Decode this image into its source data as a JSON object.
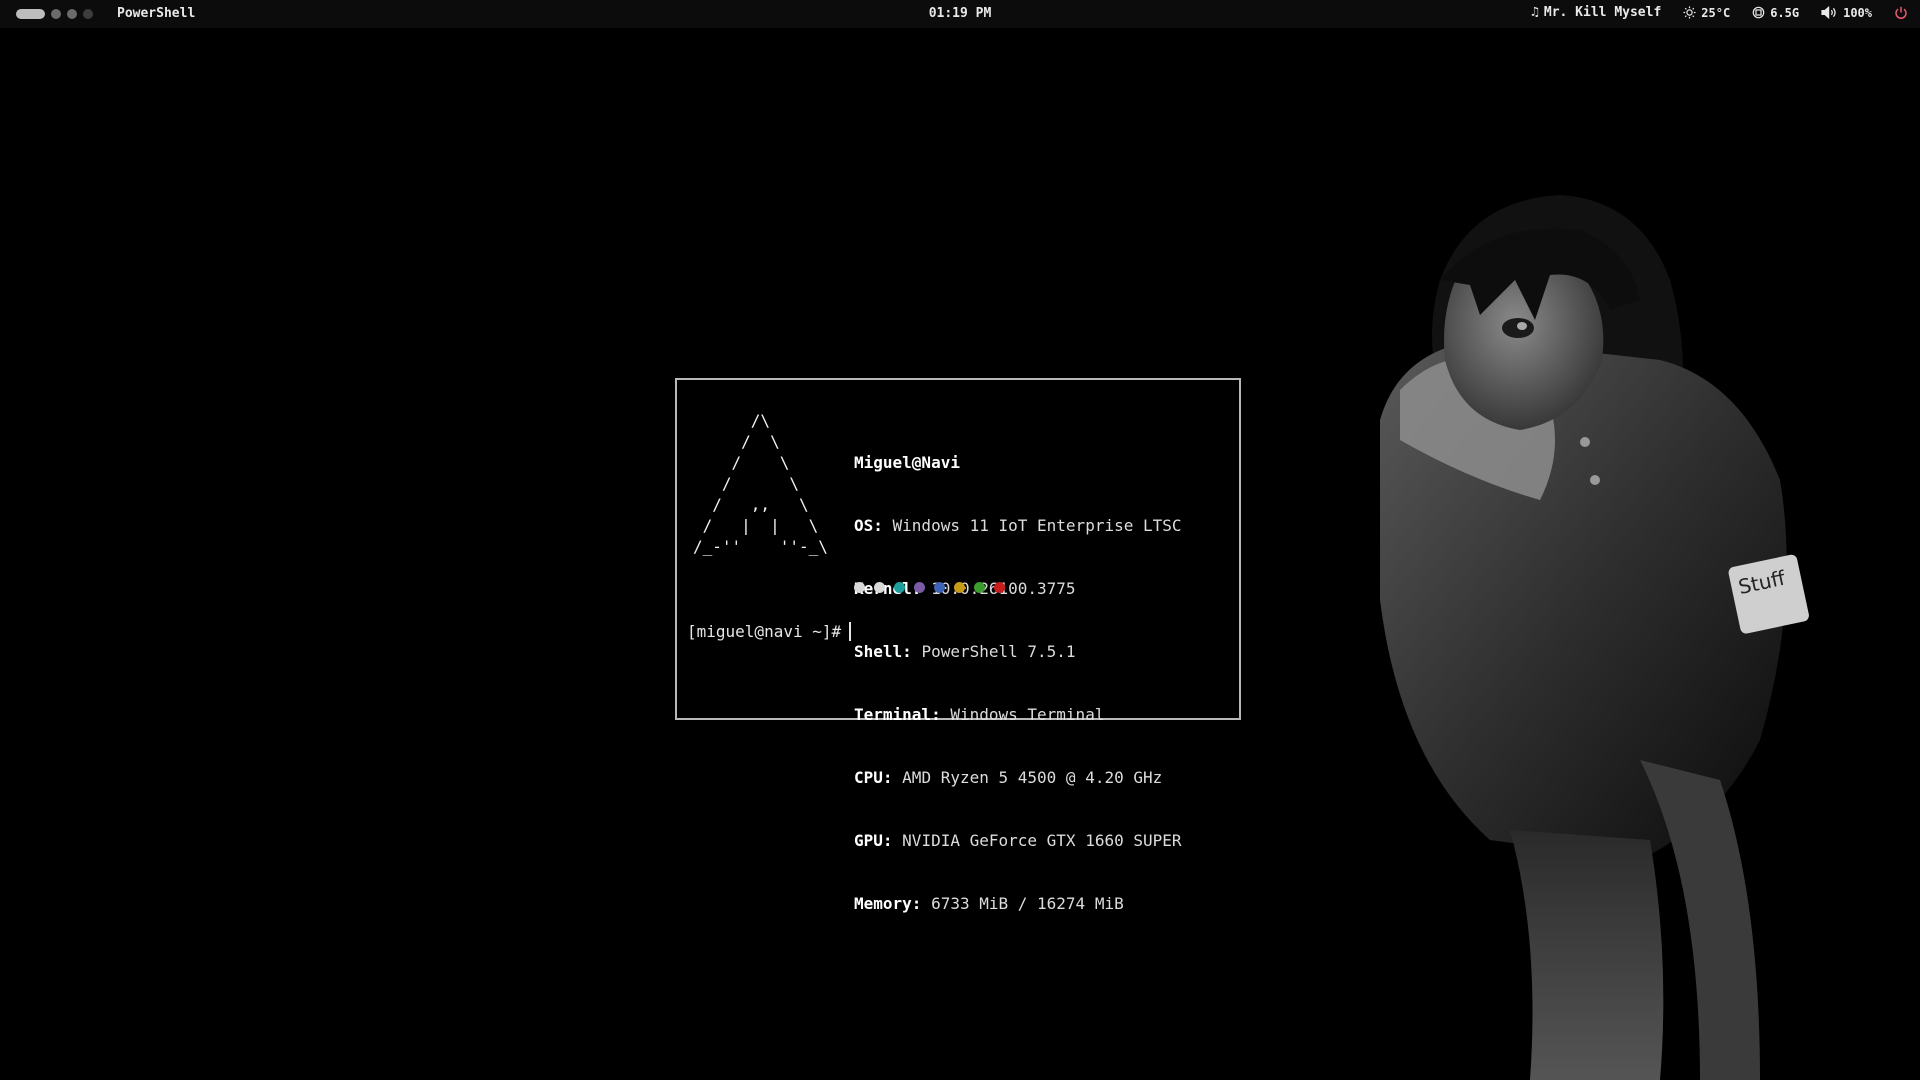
{
  "topbar": {
    "window_title": "PowerShell",
    "clock": "01:19 PM",
    "music": "Mr. Kill Myself",
    "temperature": "25°C",
    "memory": "6.5G",
    "volume": "100%"
  },
  "terminal": {
    "user_host": "Miguel@Navi",
    "logo_lines": [
      "      /\\",
      "     /  \\",
      "    /    \\",
      "   /      \\",
      "  /   ,,   \\",
      " /   |  |   \\",
      "/_-''    ''-_\\"
    ],
    "info": [
      {
        "key": "OS",
        "value": "Windows 11 IoT Enterprise LTSC"
      },
      {
        "key": "Kernel",
        "value": "10.0.26100.3775"
      },
      {
        "key": "Shell",
        "value": "PowerShell 7.5.1"
      },
      {
        "key": "Terminal",
        "value": "Windows Terminal"
      },
      {
        "key": "CPU",
        "value": "AMD Ryzen 5 4500 @ 4.20 GHz"
      },
      {
        "key": "GPU",
        "value": "NVIDIA GeForce GTX 1660 SUPER"
      },
      {
        "key": "Memory",
        "value": "6733 MiB / 16274 MiB"
      }
    ],
    "swatch_colors": [
      "#d9d9d9",
      "#d9d9d9",
      "#1f9e9e",
      "#7b5aa6",
      "#3f64b5",
      "#c99a1a",
      "#3c9c2f",
      "#c81d1d"
    ],
    "prompt": "[miguel@navi ~]#"
  },
  "colors": {
    "bar_bg": "#0c0c0c",
    "power": "#e85a6a",
    "terminal_border": "#b8b8b8"
  }
}
